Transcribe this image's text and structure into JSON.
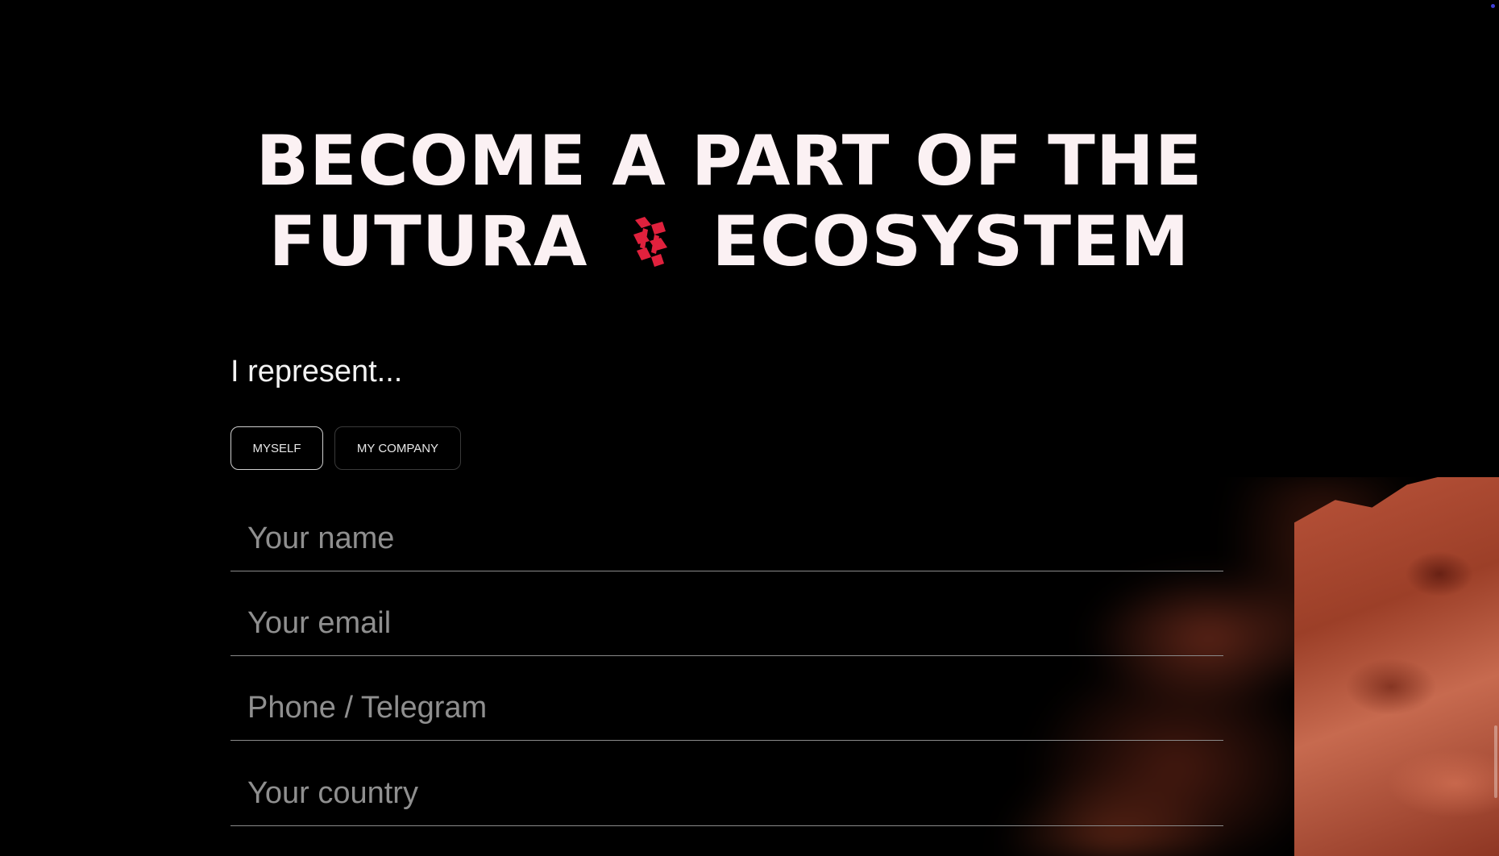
{
  "heading": {
    "line1": "BECOME A PART OF THE",
    "line2_left": "FUTURA",
    "line2_right": "ECOSYSTEM",
    "brand_icon": "futura-logo-icon"
  },
  "form": {
    "represent_label": "I represent...",
    "options": [
      {
        "label": "MYSELF",
        "selected": true
      },
      {
        "label": "MY COMPANY",
        "selected": false
      }
    ],
    "fields": [
      {
        "placeholder": "Your name",
        "value": ""
      },
      {
        "placeholder": "Your email",
        "value": ""
      },
      {
        "placeholder": "Phone / Telegram",
        "value": ""
      },
      {
        "placeholder": "Your country",
        "value": ""
      }
    ]
  },
  "colors": {
    "background": "#000000",
    "heading": "#fbf1f3",
    "accent": "#e0213d",
    "rock": "#b9533a"
  }
}
